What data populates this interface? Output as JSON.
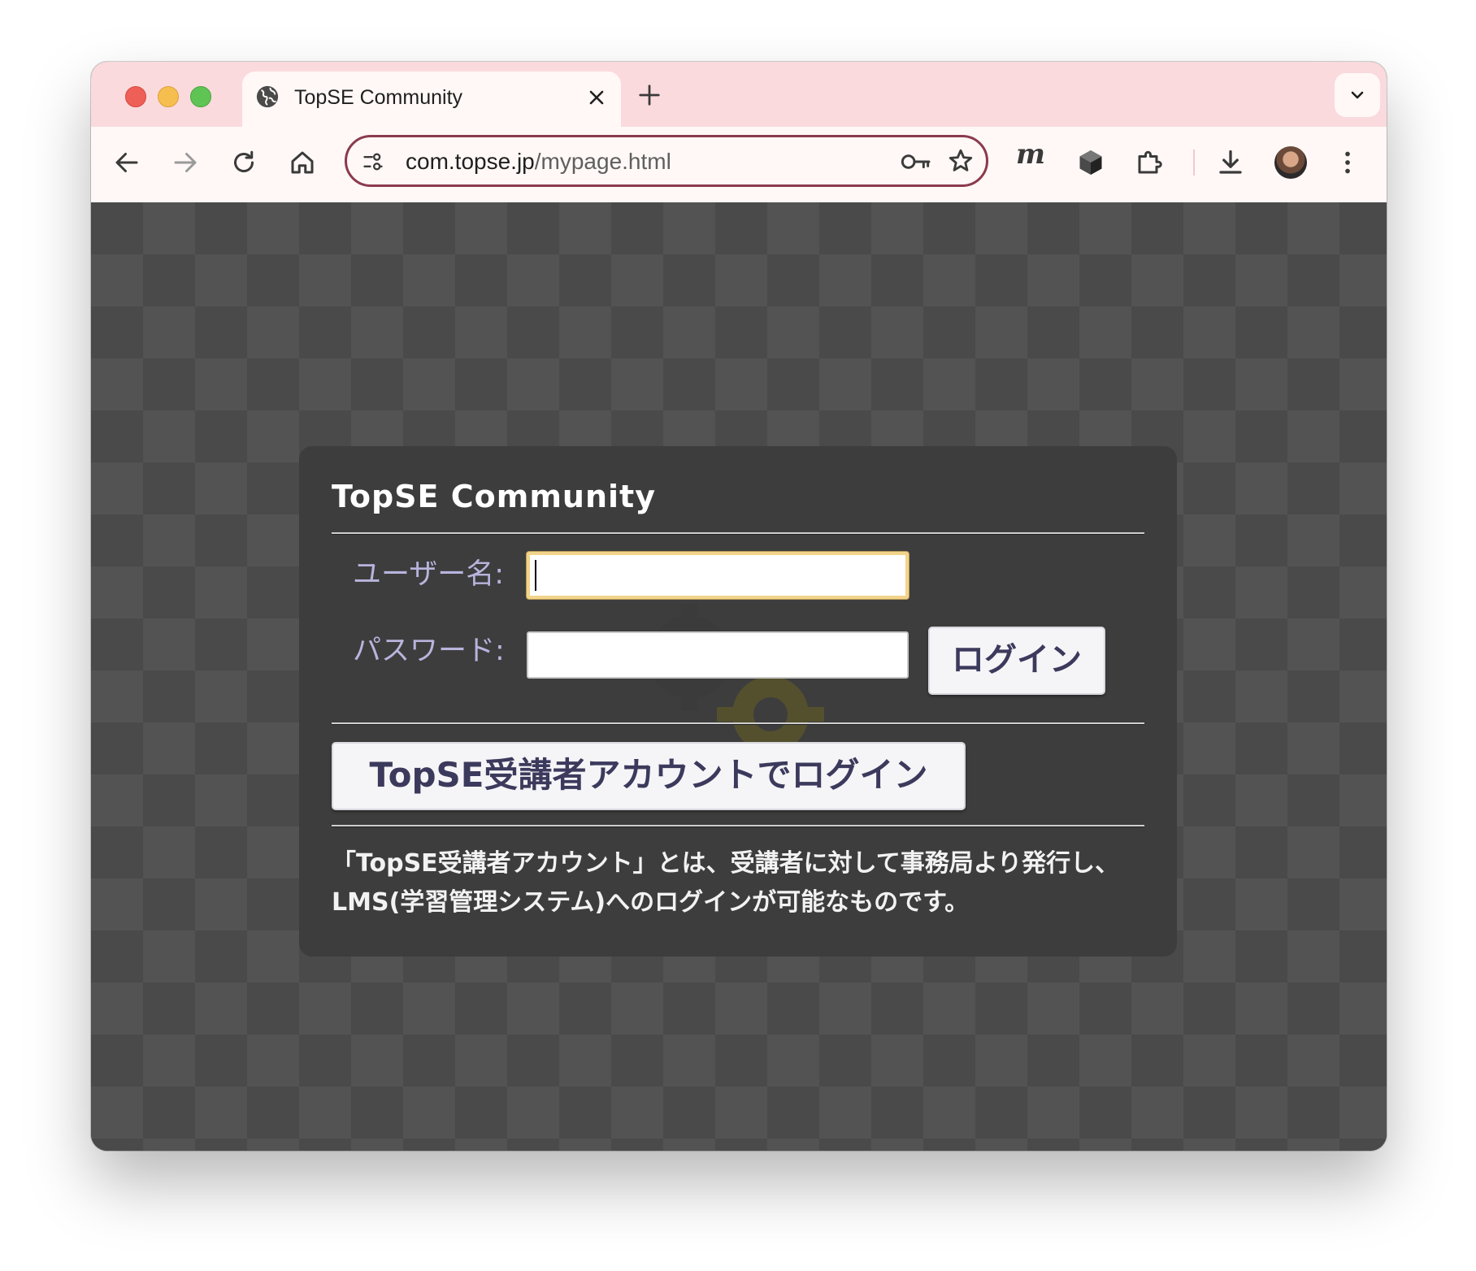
{
  "browser": {
    "tab": {
      "title": "TopSE Community",
      "icon": "globe-icon"
    },
    "address_bar": {
      "domain": "com.topse.jp",
      "path": "/mypage.html"
    },
    "extension_label": "m"
  },
  "login_panel": {
    "title": "TopSE Community",
    "username_label": "ユーザー名:",
    "username_value": "",
    "password_label": "パスワード:",
    "password_value": "",
    "login_button": "ログイン",
    "topse_login_button": "TopSE受講者アカウントでログイン",
    "description": "「TopSE受講者アカウント」とは、受講者に対して事務局より発行し、LMS(学習管理システム)へのログインが可能なものです。"
  },
  "colors": {
    "tab_strip": "#fadadd",
    "toolbar": "#fff8f6",
    "omnibox_border": "#8b3a4d",
    "label_text": "#b8b4dd",
    "button_text": "#3c3a5c",
    "focus_ring": "#f2d48a"
  }
}
